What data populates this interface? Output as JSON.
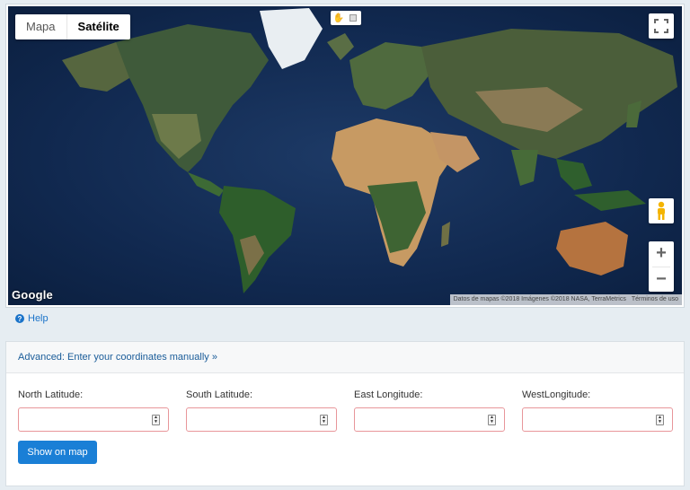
{
  "map": {
    "type_buttons": [
      {
        "label": "Mapa",
        "active": false
      },
      {
        "label": "Satélite",
        "active": true
      }
    ],
    "google_logo": "Google",
    "attribution": "Datos de mapas ©2018 Imágenes ©2018 NASA, TerraMetrics",
    "terms": "Términos de uso",
    "zoom_in": "+",
    "zoom_out": "−"
  },
  "help": {
    "label": "Help"
  },
  "advanced": {
    "toggle_label": "Advanced: Enter your coordinates manually »",
    "fields": [
      {
        "label": "North Latitude:",
        "value": ""
      },
      {
        "label": "South Latitude:",
        "value": ""
      },
      {
        "label": "East Longitude:",
        "value": ""
      },
      {
        "label": "WestLongitude:",
        "value": ""
      }
    ],
    "submit_label": "Show on map"
  },
  "colors": {
    "accent": "#1a7fd6",
    "link": "#1a5c99",
    "input_error_border": "#e8969a",
    "ocean": "#112950"
  }
}
